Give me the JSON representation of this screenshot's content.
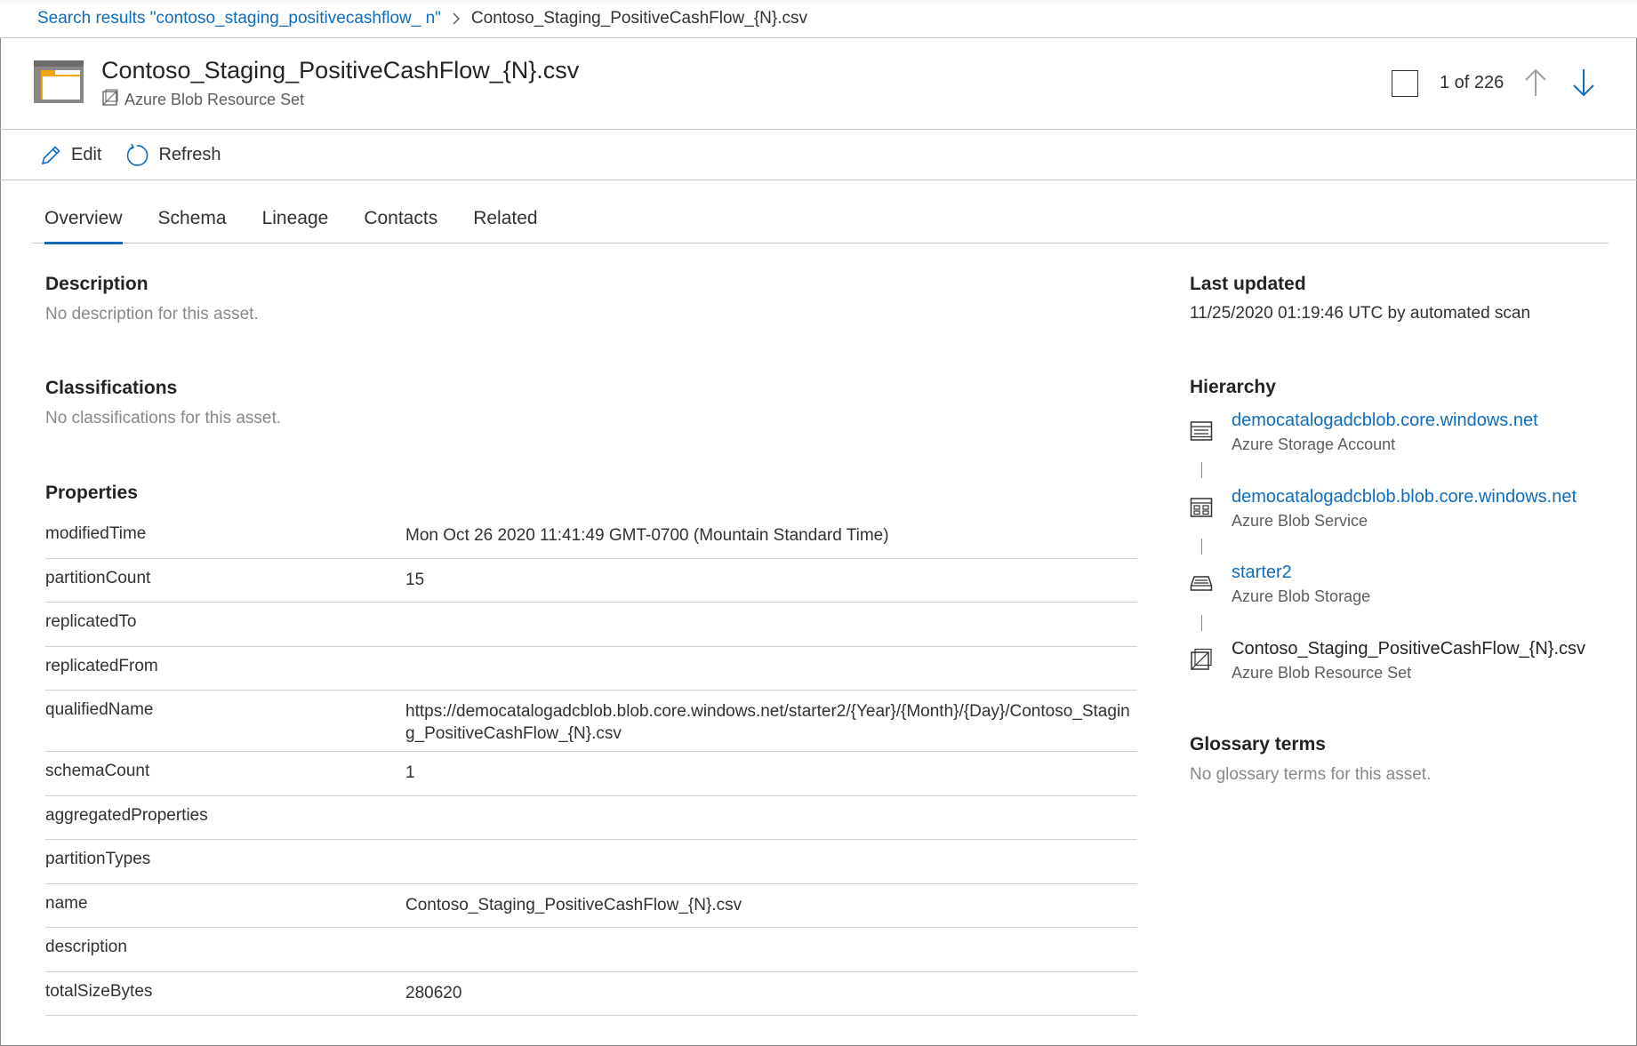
{
  "breadcrumb": {
    "search_link": "Search results \"contoso_staging_positivecashflow_ n\"",
    "current": "Contoso_Staging_PositiveCashFlow_{N}.csv"
  },
  "header": {
    "title": "Contoso_Staging_PositiveCashFlow_{N}.csv",
    "asset_type": "Azure Blob Resource Set",
    "pager": "1 of 226"
  },
  "commands": {
    "edit": "Edit",
    "refresh": "Refresh"
  },
  "tabs": [
    {
      "label": "Overview",
      "active": true
    },
    {
      "label": "Schema",
      "active": false
    },
    {
      "label": "Lineage",
      "active": false
    },
    {
      "label": "Contacts",
      "active": false
    },
    {
      "label": "Related",
      "active": false
    }
  ],
  "description": {
    "title": "Description",
    "empty": "No description for this asset."
  },
  "classifications": {
    "title": "Classifications",
    "empty": "No classifications for this asset."
  },
  "properties": {
    "title": "Properties",
    "rows": [
      {
        "key": "modifiedTime",
        "value": "Mon Oct 26 2020 11:41:49 GMT-0700 (Mountain Standard Time)"
      },
      {
        "key": "partitionCount",
        "value": "15"
      },
      {
        "key": "replicatedTo",
        "value": ""
      },
      {
        "key": "replicatedFrom",
        "value": ""
      },
      {
        "key": "qualifiedName",
        "value": "https://democatalogadcblob.blob.core.windows.net/starter2/{Year}/{Month}/{Day}/Contoso_Staging_PositiveCashFlow_{N}.csv"
      },
      {
        "key": "schemaCount",
        "value": "1"
      },
      {
        "key": "aggregatedProperties",
        "value": ""
      },
      {
        "key": "partitionTypes",
        "value": ""
      },
      {
        "key": "name",
        "value": "Contoso_Staging_PositiveCashFlow_{N}.csv"
      },
      {
        "key": "description",
        "value": ""
      },
      {
        "key": "totalSizeBytes",
        "value": "280620"
      }
    ]
  },
  "last_updated": {
    "title": "Last updated",
    "value": "11/25/2020 01:19:46 UTC by automated scan"
  },
  "hierarchy": {
    "title": "Hierarchy",
    "items": [
      {
        "name": "democatalogadcblob.core.windows.net",
        "type": "Azure Storage Account",
        "icon": "storage-account-icon"
      },
      {
        "name": "democatalogadcblob.blob.core.windows.net",
        "type": "Azure Blob Service",
        "icon": "blob-service-icon"
      },
      {
        "name": "starter2",
        "type": "Azure Blob Storage",
        "icon": "blob-container-icon"
      },
      {
        "name": "Contoso_Staging_PositiveCashFlow_{N}.csv",
        "type": "Azure Blob Resource Set",
        "icon": "resource-set-icon"
      }
    ]
  },
  "glossary": {
    "title": "Glossary terms",
    "empty": "No glossary terms for this asset."
  },
  "colors": {
    "accent": "#0f6cbd",
    "folder_orange": "#f2a40c",
    "folder_gray": "#8a8886"
  }
}
